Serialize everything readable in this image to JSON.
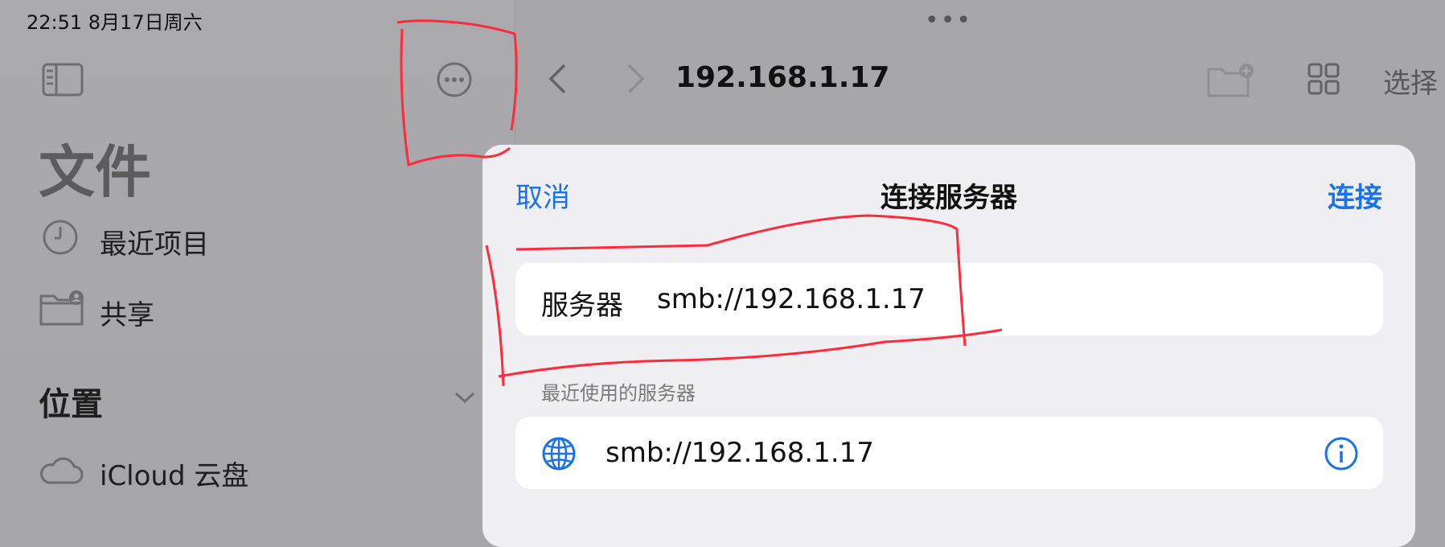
{
  "status": {
    "time_date": "22:51   8月17日周六"
  },
  "sidebar": {
    "title": "文件",
    "items": [
      {
        "label": "最近项目",
        "icon": "clock-icon"
      },
      {
        "label": "共享",
        "icon": "shared-folder-icon"
      }
    ],
    "section_title": "位置",
    "locations": [
      {
        "label": "iCloud 云盘",
        "icon": "cloud-icon"
      }
    ]
  },
  "navbar": {
    "path": "192.168.1.17",
    "select_label": "选择"
  },
  "sheet": {
    "cancel_label": "取消",
    "title": "连接服务器",
    "connect_label": "连接",
    "server_label": "服务器",
    "server_value": "smb://192.168.1.17",
    "recent_header": "最近使用的服务器",
    "recent_servers": [
      "smb://192.168.1.17"
    ]
  },
  "colors": {
    "accent": "#1a72e8",
    "annotation": "#ff2b3a"
  }
}
